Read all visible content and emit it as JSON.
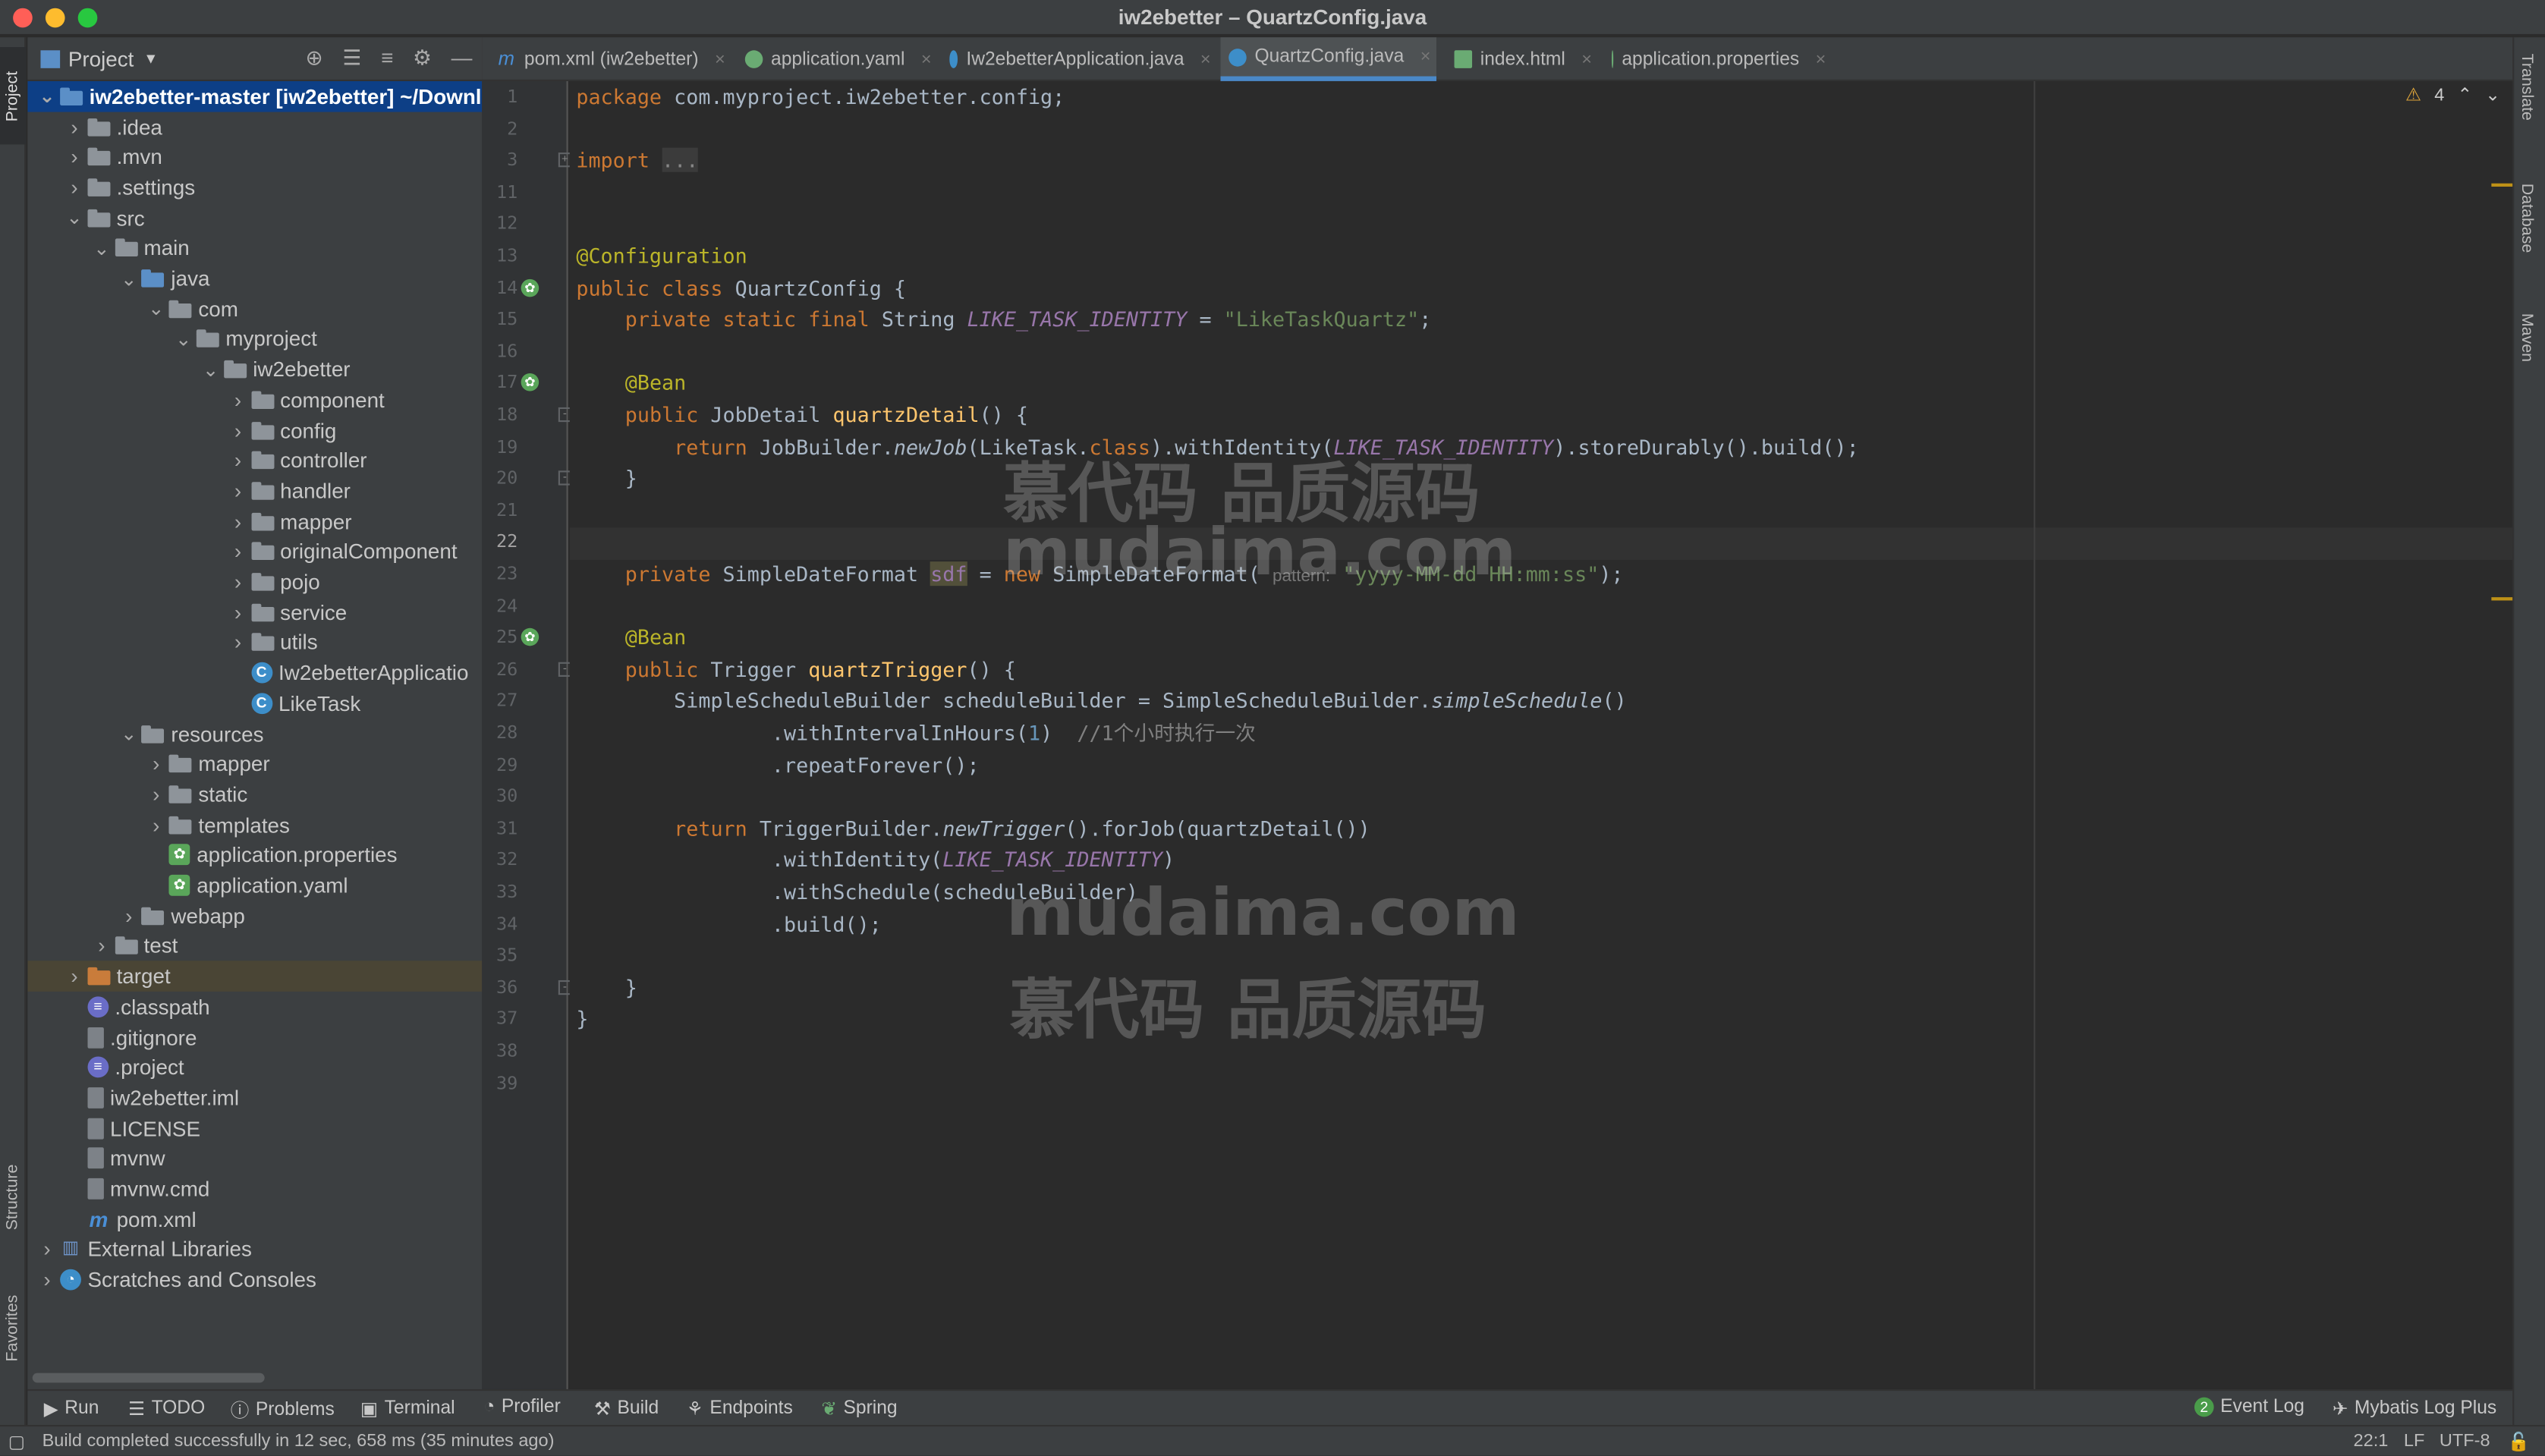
{
  "window": {
    "title": "iw2ebetter – QuartzConfig.java"
  },
  "left_tool_tabs": {
    "project": "Project",
    "structure": "Structure",
    "favorites": "Favorites"
  },
  "right_tool_tabs": {
    "translate": "Translate",
    "database": "Database",
    "maven": "Maven"
  },
  "project_panel": {
    "title": "Project"
  },
  "tree": [
    {
      "label": "iw2ebetter-master [iw2ebetter] ~/Downl",
      "depth": 0,
      "expanded": true,
      "type": "module",
      "selected": true
    },
    {
      "label": ".idea",
      "depth": 1,
      "expanded": false,
      "type": "folder"
    },
    {
      "label": ".mvn",
      "depth": 1,
      "expanded": false,
      "type": "folder"
    },
    {
      "label": ".settings",
      "depth": 1,
      "expanded": false,
      "type": "folder"
    },
    {
      "label": "src",
      "depth": 1,
      "expanded": true,
      "type": "folder"
    },
    {
      "label": "main",
      "depth": 2,
      "expanded": true,
      "type": "folder"
    },
    {
      "label": "java",
      "depth": 3,
      "expanded": true,
      "type": "folder-blue"
    },
    {
      "label": "com",
      "depth": 4,
      "expanded": true,
      "type": "folder"
    },
    {
      "label": "myproject",
      "depth": 5,
      "expanded": true,
      "type": "folder"
    },
    {
      "label": "iw2ebetter",
      "depth": 6,
      "expanded": true,
      "type": "folder"
    },
    {
      "label": "component",
      "depth": 7,
      "expanded": false,
      "type": "folder"
    },
    {
      "label": "config",
      "depth": 7,
      "expanded": false,
      "type": "folder"
    },
    {
      "label": "controller",
      "depth": 7,
      "expanded": false,
      "type": "folder"
    },
    {
      "label": "handler",
      "depth": 7,
      "expanded": false,
      "type": "folder"
    },
    {
      "label": "mapper",
      "depth": 7,
      "expanded": false,
      "type": "folder"
    },
    {
      "label": "originalComponent",
      "depth": 7,
      "expanded": false,
      "type": "folder"
    },
    {
      "label": "pojo",
      "depth": 7,
      "expanded": false,
      "type": "folder"
    },
    {
      "label": "service",
      "depth": 7,
      "expanded": false,
      "type": "folder"
    },
    {
      "label": "utils",
      "depth": 7,
      "expanded": false,
      "type": "folder"
    },
    {
      "label": "Iw2ebetterApplicatio",
      "depth": 7,
      "type": "class"
    },
    {
      "label": "LikeTask",
      "depth": 7,
      "type": "class"
    },
    {
      "label": "resources",
      "depth": 3,
      "expanded": true,
      "type": "folder-res"
    },
    {
      "label": "mapper",
      "depth": 4,
      "expanded": false,
      "type": "folder"
    },
    {
      "label": "static",
      "depth": 4,
      "expanded": false,
      "type": "folder"
    },
    {
      "label": "templates",
      "depth": 4,
      "expanded": false,
      "type": "folder"
    },
    {
      "label": "application.properties",
      "depth": 4,
      "type": "spring"
    },
    {
      "label": "application.yaml",
      "depth": 4,
      "type": "spring"
    },
    {
      "label": "webapp",
      "depth": 3,
      "expanded": false,
      "type": "folder"
    },
    {
      "label": "test",
      "depth": 2,
      "expanded": false,
      "type": "folder"
    },
    {
      "label": "target",
      "depth": 1,
      "expanded": false,
      "type": "folder-orange",
      "highlight": true
    },
    {
      "label": ".classpath",
      "depth": 1,
      "type": "classpath"
    },
    {
      "label": ".gitignore",
      "depth": 1,
      "type": "file"
    },
    {
      "label": ".project",
      "depth": 1,
      "type": "classpath"
    },
    {
      "label": "iw2ebetter.iml",
      "depth": 1,
      "type": "file"
    },
    {
      "label": "LICENSE",
      "depth": 1,
      "type": "file"
    },
    {
      "label": "mvnw",
      "depth": 1,
      "type": "file"
    },
    {
      "label": "mvnw.cmd",
      "depth": 1,
      "type": "file"
    },
    {
      "label": "pom.xml",
      "depth": 1,
      "type": "maven"
    },
    {
      "label": "External Libraries",
      "depth": 0,
      "expanded": false,
      "type": "lib"
    },
    {
      "label": "Scratches and Consoles",
      "depth": 0,
      "expanded": false,
      "type": "scratch"
    }
  ],
  "tabs": [
    {
      "label": "pom.xml (iw2ebetter)",
      "icon": "maven-icon",
      "active": false
    },
    {
      "label": "application.yaml",
      "icon": "spring-icon",
      "active": false
    },
    {
      "label": "Iw2ebetterApplication.java",
      "icon": "class-icon",
      "active": false
    },
    {
      "label": "QuartzConfig.java",
      "icon": "class-icon",
      "active": true
    },
    {
      "label": "index.html",
      "icon": "html-icon",
      "active": false
    },
    {
      "label": "application.properties",
      "icon": "spring-icon",
      "active": false
    }
  ],
  "editor": {
    "warnings": "4",
    "current_line": 22,
    "lines": [
      {
        "n": "1",
        "code": "package com.myproject.iw2ebetter.config;"
      },
      {
        "n": "2",
        "code": ""
      },
      {
        "n": "3",
        "code": "import ..."
      },
      {
        "n": "11",
        "code": ""
      },
      {
        "n": "12",
        "code": ""
      },
      {
        "n": "13",
        "code": "@Configuration"
      },
      {
        "n": "14",
        "code": "public class QuartzConfig {"
      },
      {
        "n": "15",
        "code": "    private static final String LIKE_TASK_IDENTITY = \"LikeTaskQuartz\";"
      },
      {
        "n": "16",
        "code": ""
      },
      {
        "n": "17",
        "code": "    @Bean"
      },
      {
        "n": "18",
        "code": "    public JobDetail quartzDetail() {"
      },
      {
        "n": "19",
        "code": "        return JobBuilder.newJob(LikeTask.class).withIdentity(LIKE_TASK_IDENTITY).storeDurably().build();"
      },
      {
        "n": "20",
        "code": "    }"
      },
      {
        "n": "21",
        "code": ""
      },
      {
        "n": "22",
        "code": ""
      },
      {
        "n": "23",
        "code": "    private SimpleDateFormat sdf = new SimpleDateFormat( pattern: \"yyyy-MM-dd HH:mm:ss\");"
      },
      {
        "n": "24",
        "code": ""
      },
      {
        "n": "25",
        "code": "    @Bean"
      },
      {
        "n": "26",
        "code": "    public Trigger quartzTrigger() {"
      },
      {
        "n": "27",
        "code": "        SimpleScheduleBuilder scheduleBuilder = SimpleScheduleBuilder.simpleSchedule()"
      },
      {
        "n": "28",
        "code": "                .withIntervalInHours(1)  //1个小时执行一次"
      },
      {
        "n": "29",
        "code": "                .repeatForever();"
      },
      {
        "n": "30",
        "code": ""
      },
      {
        "n": "31",
        "code": "        return TriggerBuilder.newTrigger().forJob(quartzDetail())"
      },
      {
        "n": "32",
        "code": "                .withIdentity(LIKE_TASK_IDENTITY)"
      },
      {
        "n": "33",
        "code": "                .withSchedule(scheduleBuilder)"
      },
      {
        "n": "34",
        "code": "                .build();"
      },
      {
        "n": "35",
        "code": ""
      },
      {
        "n": "36",
        "code": "    }"
      },
      {
        "n": "37",
        "code": "}"
      },
      {
        "n": "38",
        "code": ""
      },
      {
        "n": "39",
        "code": ""
      }
    ]
  },
  "watermarks": {
    "line1": "慕代码 品质源码",
    "line2": "mudaima.com",
    "line3": "mudaima.com",
    "line4": "慕代码 品质源码"
  },
  "bottom_toolbar": {
    "run": "Run",
    "todo": "TODO",
    "problems": "Problems",
    "terminal": "Terminal",
    "profiler": "Profiler",
    "build": "Build",
    "endpoints": "Endpoints",
    "spring": "Spring",
    "event_log": "Event Log",
    "event_count": "2",
    "mybatis": "Mybatis Log Plus"
  },
  "status": {
    "message": "Build completed successfully in 12 sec, 658 ms (35 minutes ago)",
    "position": "22:1",
    "line_sep": "LF",
    "encoding": "UTF-8"
  },
  "colors": {
    "keyword": "#cc7832",
    "annotation": "#bbb529",
    "string": "#6a8759",
    "constant": "#9876aa",
    "method": "#ffc66d",
    "comment": "#808080",
    "number": "#6897bb",
    "selection": "#0d3f86",
    "accent": "#4a88c7"
  }
}
